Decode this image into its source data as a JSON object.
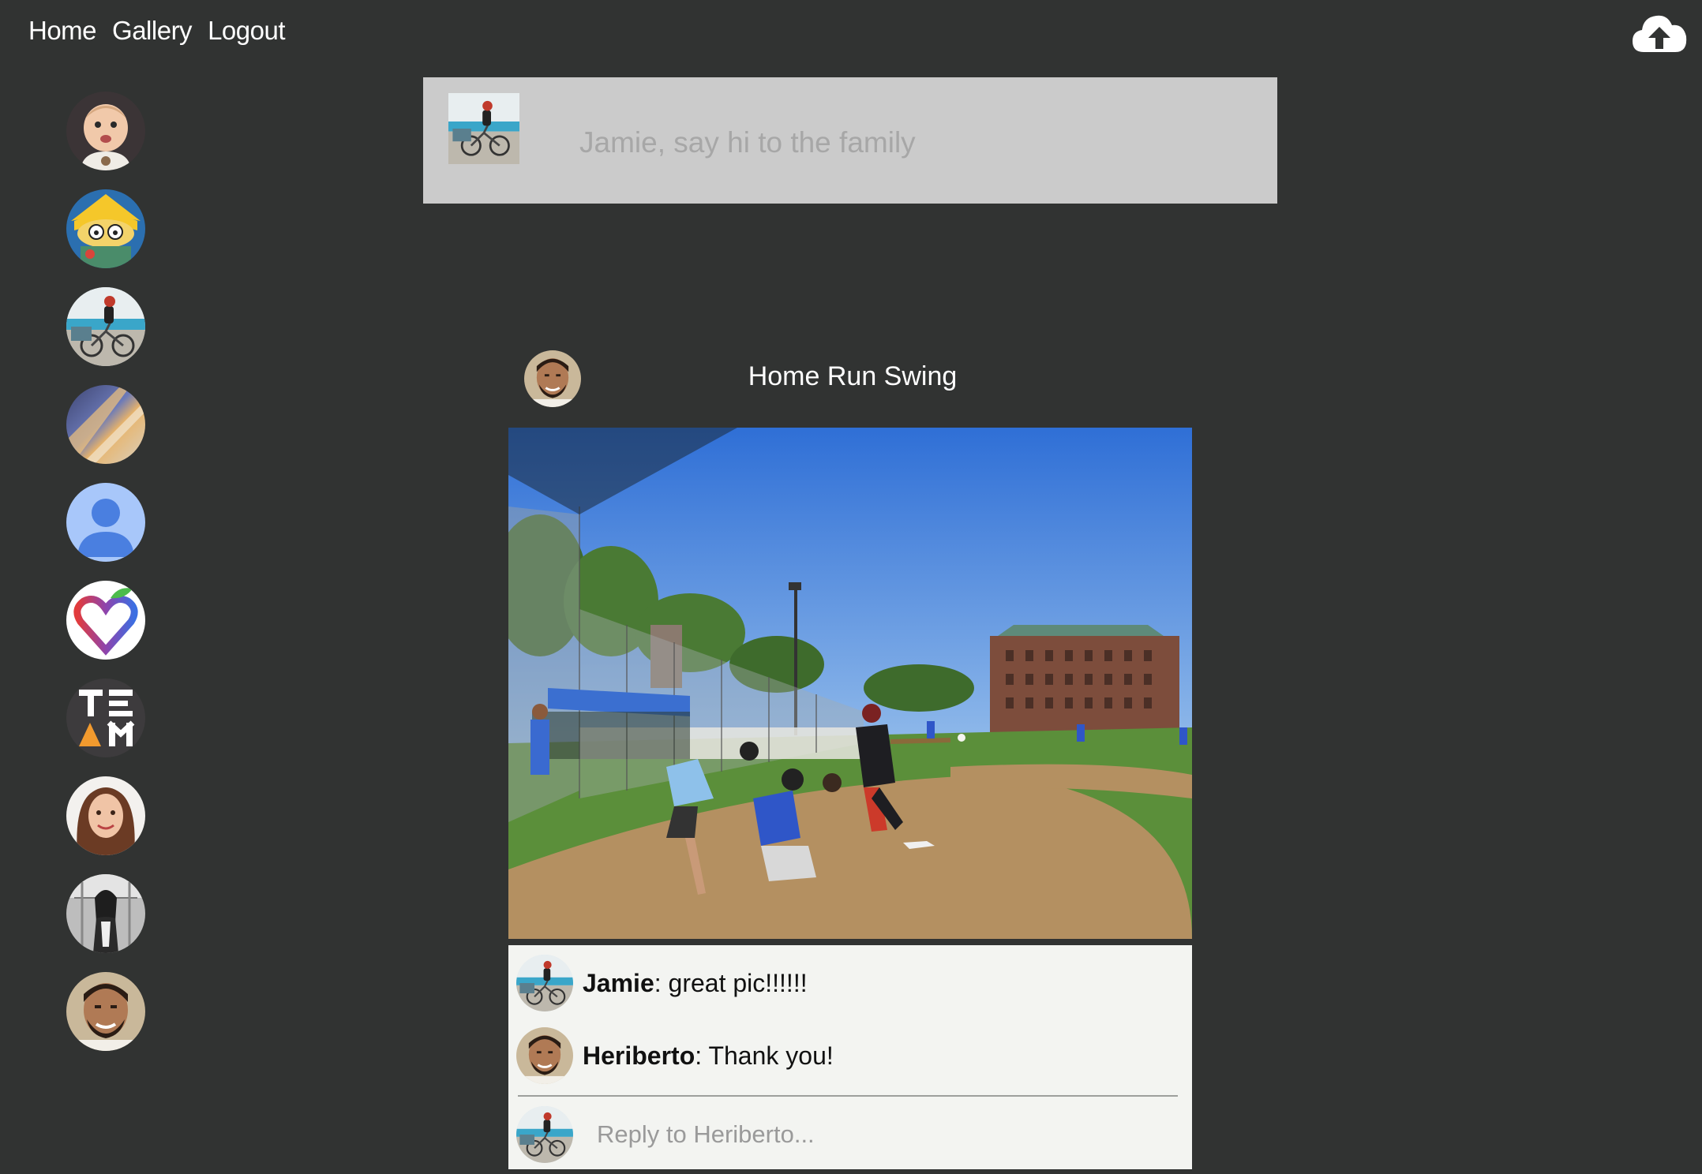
{
  "nav": {
    "home": "Home",
    "gallery": "Gallery",
    "logout": "Logout"
  },
  "upload": {
    "icon": "cloud-upload-icon"
  },
  "sidebar": {
    "avatars": [
      {
        "name": "baby-avatar"
      },
      {
        "name": "cartoon-avatar"
      },
      {
        "name": "cyclist-avatar"
      },
      {
        "name": "abstract-avatar"
      },
      {
        "name": "default-user-avatar"
      },
      {
        "name": "apple-heart-avatar"
      },
      {
        "name": "team-logo-avatar"
      },
      {
        "name": "woman-avatar"
      },
      {
        "name": "bw-portrait-avatar"
      },
      {
        "name": "heriberto-avatar"
      }
    ]
  },
  "composer": {
    "placeholder": "Jamie, say hi to the family"
  },
  "post": {
    "title": "Home Run Swing"
  },
  "comments": [
    {
      "name": "Jamie",
      "text": ": great pic!!!!!!"
    },
    {
      "name": "Heriberto",
      "text": ": Thank you!"
    }
  ],
  "reply": {
    "placeholder": "Reply to Heriberto..."
  },
  "colors": {
    "background": "#313332",
    "composer": "#cbcbcb",
    "comments_panel": "#f3f4f1"
  }
}
